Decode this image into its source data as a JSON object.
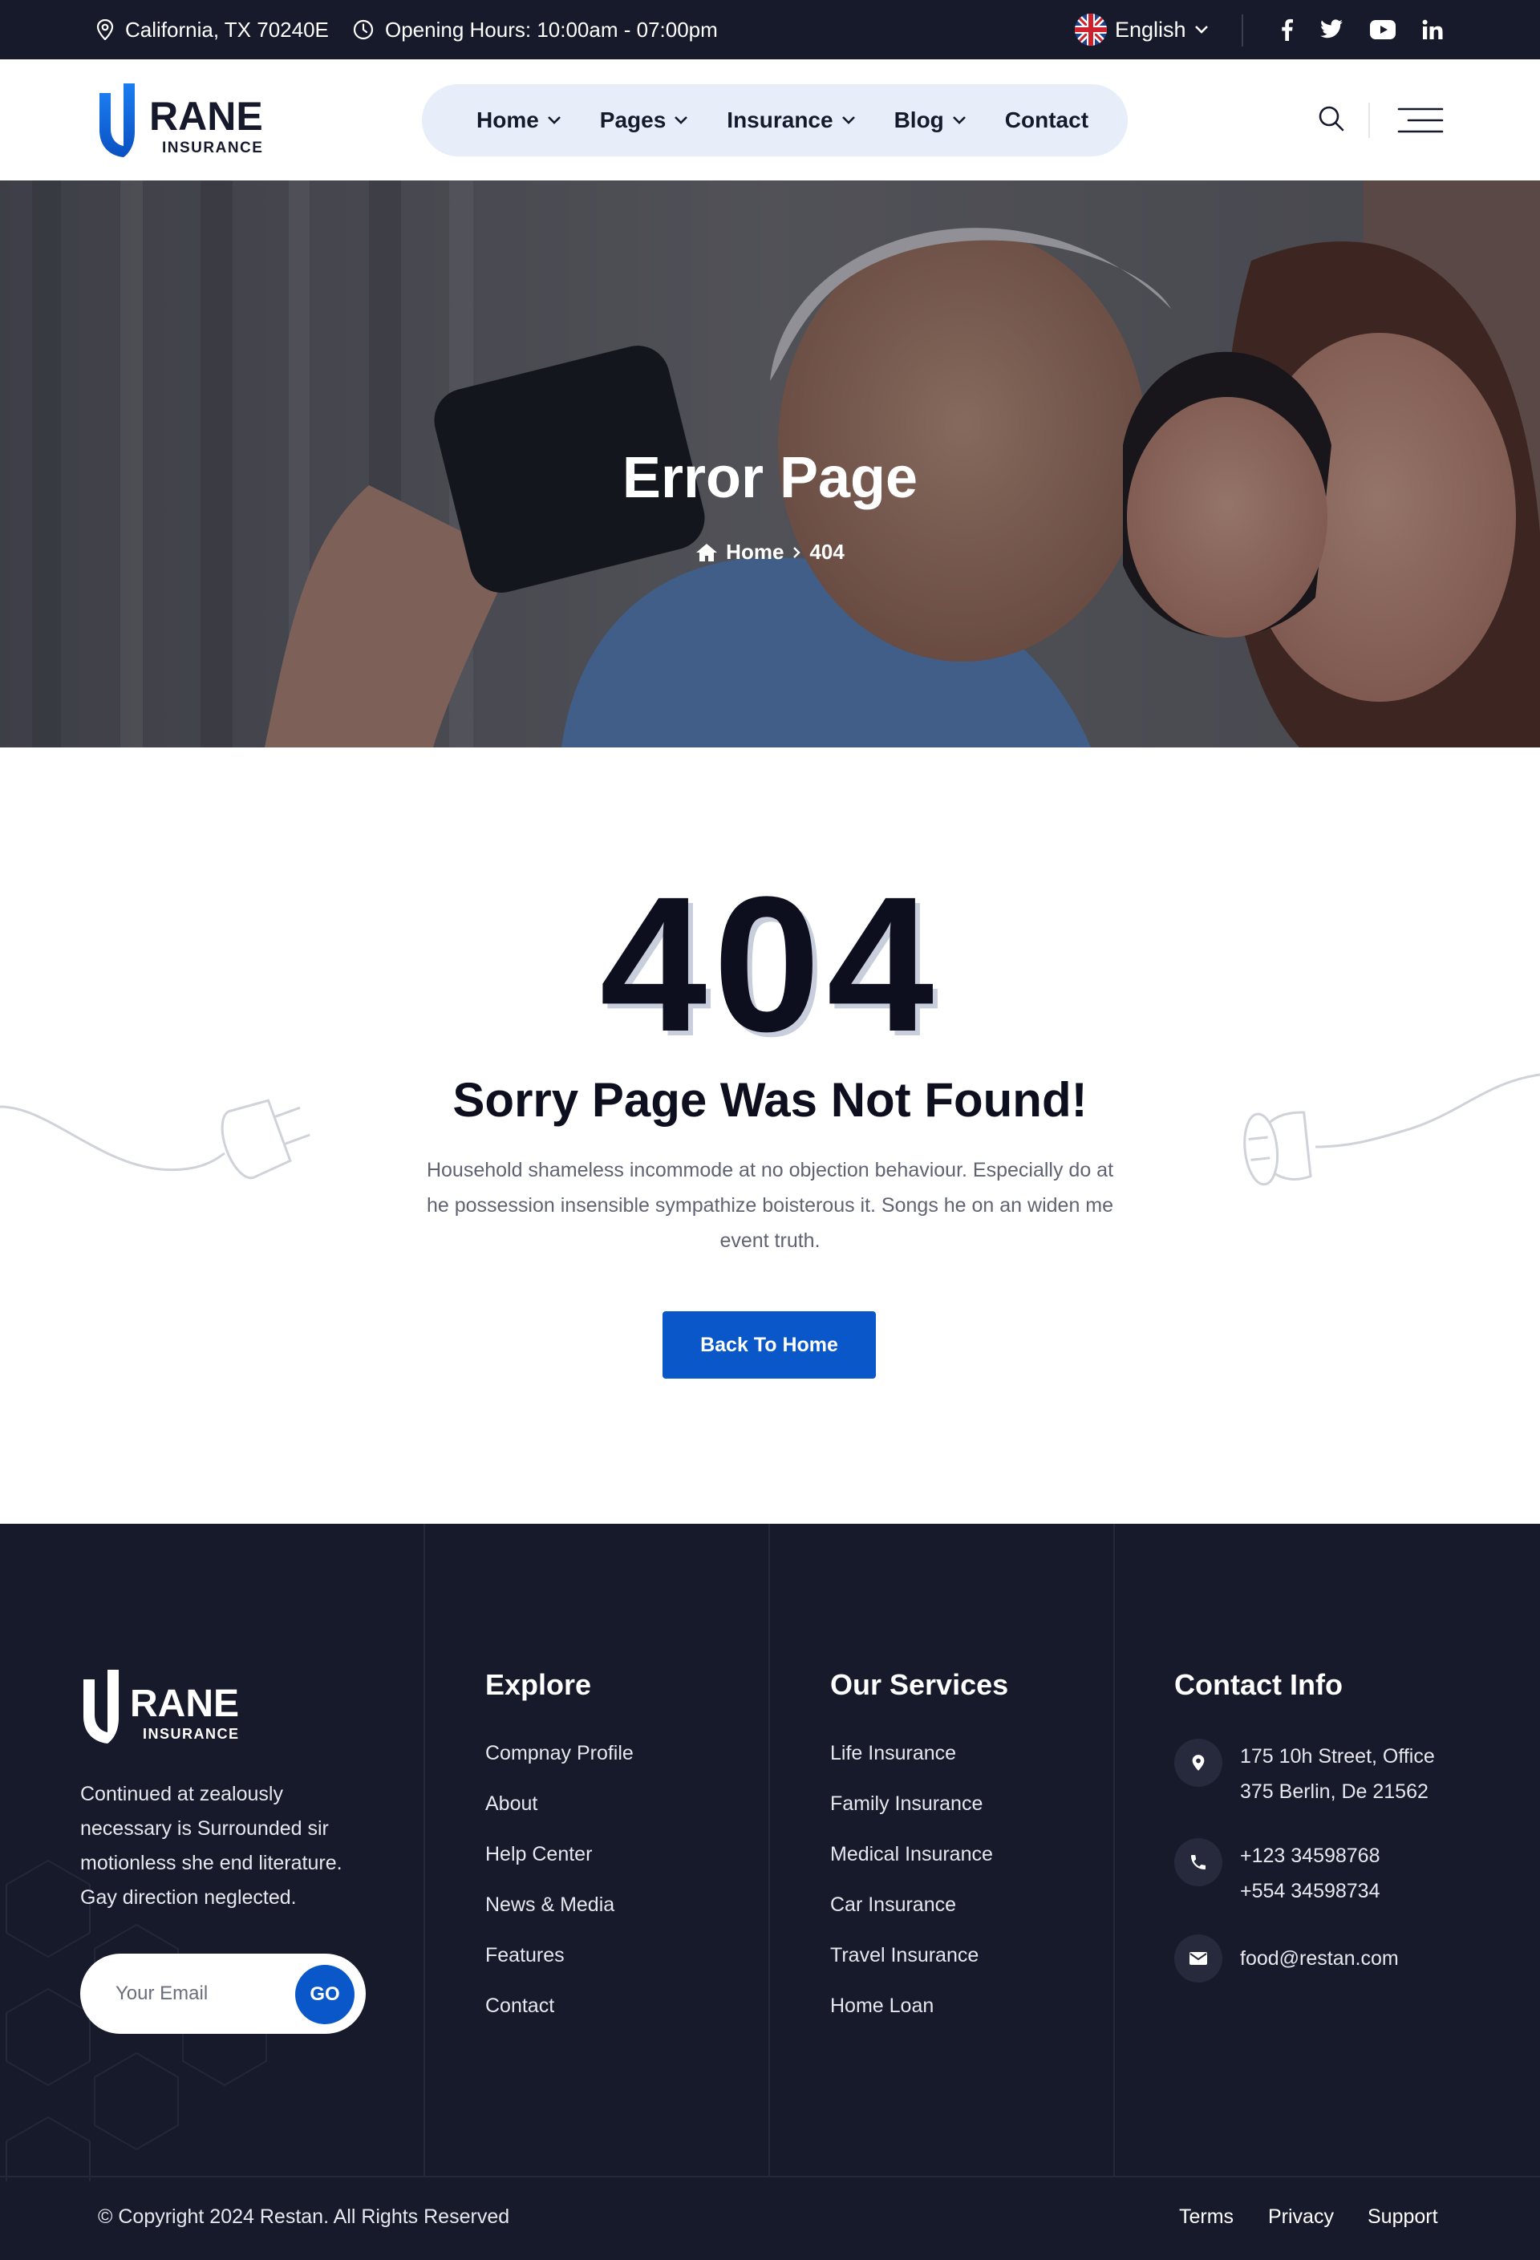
{
  "topbar": {
    "location": "California, TX 70240E",
    "hours": "Opening Hours: 10:00am - 07:00pm",
    "language": "English",
    "social_icons": [
      "facebook-icon",
      "twitter-icon",
      "youtube-icon",
      "linkedin-icon"
    ]
  },
  "header": {
    "logo_text": "RANE",
    "logo_subtext": "INSURANCE",
    "nav": [
      {
        "label": "Home",
        "has_dropdown": true
      },
      {
        "label": "Pages",
        "has_dropdown": true
      },
      {
        "label": "Insurance",
        "has_dropdown": true
      },
      {
        "label": "Blog",
        "has_dropdown": true
      },
      {
        "label": "Contact",
        "has_dropdown": false
      }
    ]
  },
  "hero": {
    "title": "Error Page",
    "breadcrumb_home": "Home",
    "breadcrumb_current": "404"
  },
  "error": {
    "code": "404",
    "heading": "Sorry Page Was Not Found!",
    "description": "Household shameless incommode at no objection behaviour. Especially do at he possession insensible sympathize boisterous it. Songs he on an widen me event truth.",
    "button_label": "Back To Home"
  },
  "footer": {
    "logo_text": "RANE",
    "logo_subtext": "INSURANCE",
    "about": "Continued at zealously necessary is Surrounded sir motionless she end literature. Gay direction neglected.",
    "email_placeholder": "Your Email",
    "go_label": "GO",
    "explore": {
      "title": "Explore",
      "links": [
        "Compnay Profile",
        "About",
        "Help Center",
        "News & Media",
        "Features",
        "Contact"
      ]
    },
    "services": {
      "title": "Our Services",
      "links": [
        "Life Insurance",
        "Family Insurance",
        "Medical Insurance",
        "Car Insurance",
        "Travel Insurance",
        "Home Loan"
      ]
    },
    "contact": {
      "title": "Contact Info",
      "address_line1": "175 10h Street, Office",
      "address_line2": "375 Berlin, De 21562",
      "phone1": "+123 34598768",
      "phone2": "+554 34598734",
      "email": "food@restan.com"
    },
    "copyright": "© Copyright 2024 Restan. All Rights Reserved",
    "legal": [
      "Terms",
      "Privacy",
      "Support"
    ]
  },
  "colors": {
    "dark_navy": "#161a2b",
    "brand_blue": "#0957c8",
    "nav_pill": "#e7eef9"
  }
}
